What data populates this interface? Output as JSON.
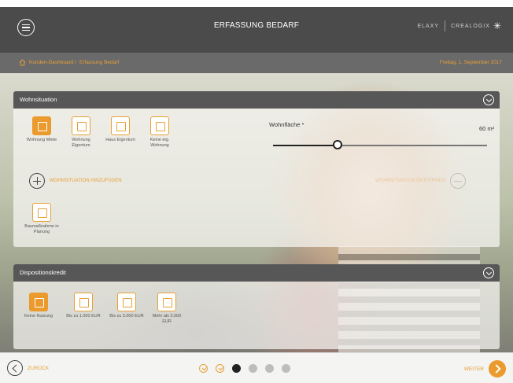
{
  "header": {
    "title": "ERFASSUNG BEDARF",
    "brand_left": "ELAXY",
    "brand_right": "CREALOGIX"
  },
  "breadcrumb": {
    "items": [
      "Kunden-Dashboard /",
      "Erfassung Bedarf"
    ],
    "date": "Freitag, 1. September 2017"
  },
  "wohnsituation": {
    "title": "Wohnsituation",
    "options": [
      {
        "label": "Wohnung Miete",
        "active": true
      },
      {
        "label": "Wohnung Eigentum",
        "active": false
      },
      {
        "label": "Haus Eigentum",
        "active": false
      },
      {
        "label": "Keine eig. Wohnung",
        "active": false
      }
    ],
    "slider": {
      "label": "Wohnfläche *",
      "value": "60 m²",
      "level": 0.3
    },
    "add_label": "WOHNSITUATION HINZUFÜGEN",
    "remove_label": "WOHNSITUATION ENTFERNEN",
    "extra_option": "Baumaßnahme in Planung"
  },
  "dispositionskredit": {
    "title": "Dispositionskredit",
    "options": [
      {
        "label": "Keine Nutzung",
        "active": true
      },
      {
        "label": "Bis zu 1.000 EUR",
        "active": false
      },
      {
        "label": "Bis zu 3.000 EUR",
        "active": false
      },
      {
        "label": "Mehr als 3.000 EUR",
        "active": false
      }
    ]
  },
  "footer": {
    "back_label": "ZURÜCK",
    "next_label": "WEITER",
    "steps": [
      "done",
      "done",
      "current",
      "todo",
      "todo",
      "todo"
    ]
  },
  "colors": {
    "accent": "#eb9a2e",
    "header": "#4b4b4b",
    "panel_head": "#575757"
  }
}
